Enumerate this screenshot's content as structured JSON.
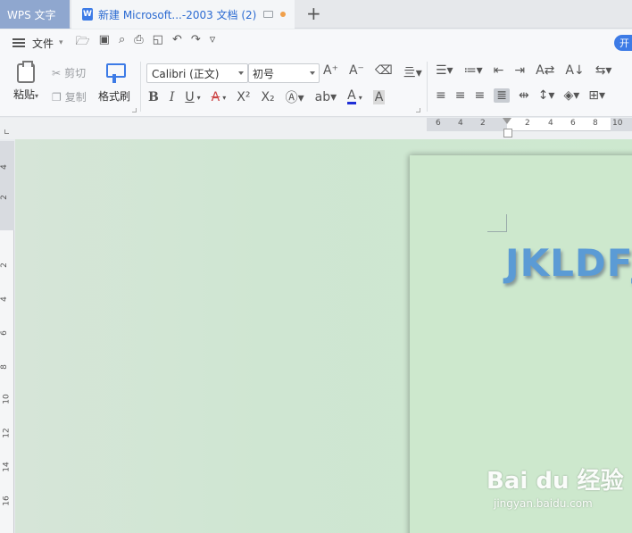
{
  "tabs": {
    "app_tab": "WPS 文字",
    "doc_tab": "新建 Microsoft...-2003 文档 (2)",
    "new_tab": "+"
  },
  "menu": {
    "file": "文件",
    "start": "开"
  },
  "ribbon": {
    "paste": "粘贴",
    "cut": "剪切",
    "copy": "复制",
    "format_painter": "格式刷",
    "font_name": "Calibri (正文)",
    "font_size": "初号",
    "bold": "B",
    "italic": "I",
    "underline": "U",
    "strike": "A",
    "superscript": "X²",
    "subscript": "X₂",
    "font_color": "A",
    "highlight": "A"
  },
  "ruler": {
    "h_ticks": [
      "6",
      "4",
      "2",
      "2",
      "2",
      "4",
      "6",
      "8",
      "10"
    ],
    "v_ticks": [
      "4",
      "2",
      "2",
      "4",
      "6",
      "8",
      "10",
      "12",
      "14",
      "16"
    ]
  },
  "document": {
    "text": "JKLDFJC"
  },
  "watermark": {
    "logo": "Bai du 经验",
    "url": "jingyan.baidu.com"
  },
  "colors": {
    "accent": "#3d7be6",
    "canvas": "#cfe6d2",
    "doc_text": "#5b9bd5"
  }
}
